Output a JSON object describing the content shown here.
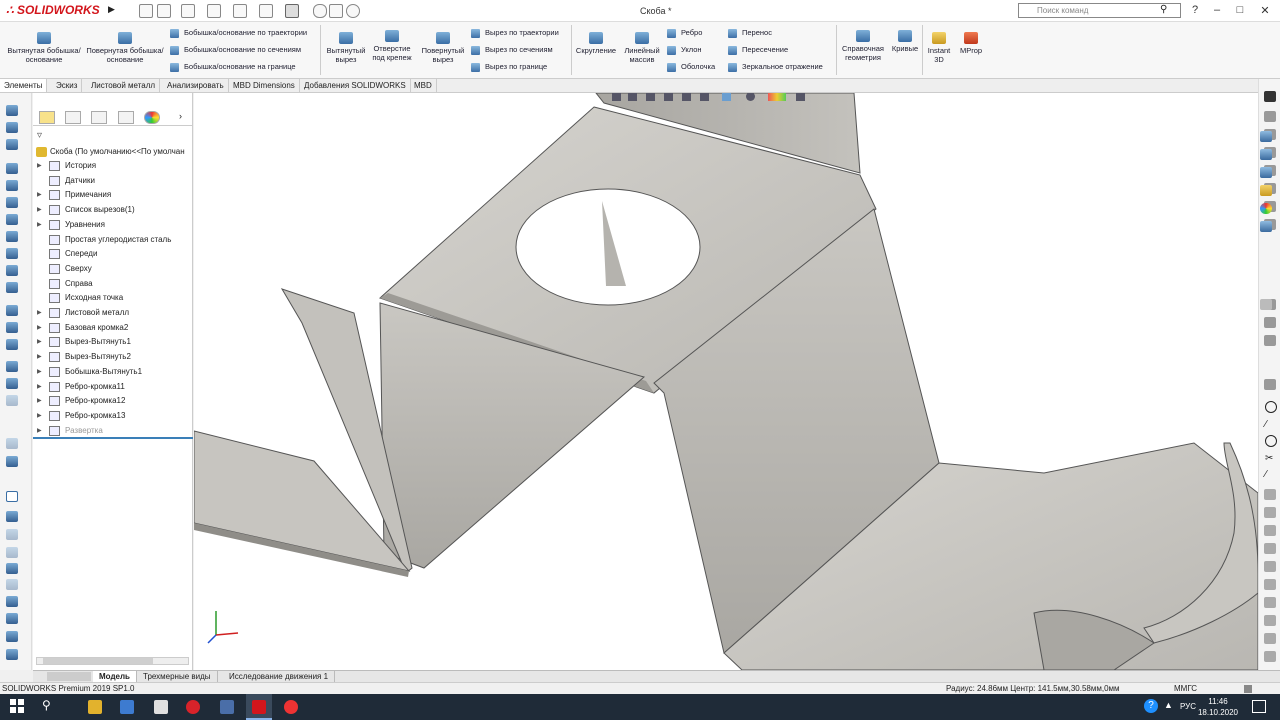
{
  "app": {
    "brand": "SOLIDWORKS",
    "document_title": "Скоба *",
    "search_placeholder": "Поиск команд"
  },
  "ribbon": {
    "big_buttons": [
      {
        "label": "Вытянутая бобышка/основание"
      },
      {
        "label": "Повернутая бобышка/основание"
      },
      {
        "label": "Вытянутый вырез"
      },
      {
        "label": "Отверстие под крепеж"
      },
      {
        "label": "Повернутый вырез"
      },
      {
        "label": "Скругление"
      },
      {
        "label": "Линейный массив"
      },
      {
        "label": "Справочная геометрия"
      },
      {
        "label": "Кривые"
      },
      {
        "label": "Instant 3D"
      },
      {
        "label": "MProp"
      }
    ],
    "boss_rows": [
      "Бобышка/основание по траектории",
      "Бобышка/основание по сечениям",
      "Бобышка/основание на границе"
    ],
    "cut_rows": [
      "Вырез по траектории",
      "Вырез по сечениям",
      "Вырез по границе"
    ],
    "feature_rows": [
      "Ребро",
      "Уклон",
      "Оболочка"
    ],
    "transform_rows": [
      "Перенос",
      "Пересечение",
      "Зеркальное отражение"
    ]
  },
  "command_tabs": [
    "Элементы",
    "Эскиз",
    "Листовой металл",
    "Анализировать",
    "MBD Dimensions",
    "Добавления SOLIDWORKS",
    "MBD"
  ],
  "tree": {
    "root": "Скоба  (По умолчанию<<По умолчан",
    "items": [
      {
        "label": "История",
        "expandable": true,
        "icon": "history-icon"
      },
      {
        "label": "Датчики",
        "expandable": false,
        "icon": "sensor-icon"
      },
      {
        "label": "Примечания",
        "expandable": true,
        "icon": "annotation-icon"
      },
      {
        "label": "Список вырезов(1)",
        "expandable": true,
        "icon": "cutlist-icon"
      },
      {
        "label": "Уравнения",
        "expandable": true,
        "icon": "equation-icon"
      },
      {
        "label": "Простая углеродистая сталь",
        "expandable": false,
        "icon": "material-icon"
      },
      {
        "label": "Спереди",
        "expandable": false,
        "icon": "plane-icon"
      },
      {
        "label": "Сверху",
        "expandable": false,
        "icon": "plane-icon"
      },
      {
        "label": "Справа",
        "expandable": false,
        "icon": "plane-icon"
      },
      {
        "label": "Исходная точка",
        "expandable": false,
        "icon": "origin-icon"
      },
      {
        "label": "Листовой металл",
        "expandable": true,
        "icon": "sheetmetal-icon"
      },
      {
        "label": "Базовая кромка2",
        "expandable": true,
        "icon": "feature-icon"
      },
      {
        "label": "Вырез-Вытянуть1",
        "expandable": true,
        "icon": "feature-icon"
      },
      {
        "label": "Вырез-Вытянуть2",
        "expandable": true,
        "icon": "feature-icon"
      },
      {
        "label": "Бобышка-Вытянуть1",
        "expandable": true,
        "icon": "feature-icon"
      },
      {
        "label": "Ребро-кромка11",
        "expandable": true,
        "icon": "feature-icon"
      },
      {
        "label": "Ребро-кромка12",
        "expandable": true,
        "icon": "feature-icon"
      },
      {
        "label": "Ребро-кромка13",
        "expandable": true,
        "icon": "feature-icon"
      },
      {
        "label": "Развертка",
        "expandable": true,
        "icon": "flatpattern-icon",
        "muted": true
      }
    ]
  },
  "bottom_tabs": [
    "Модель",
    "Трехмерные виды",
    "Исследование движения 1"
  ],
  "status": {
    "product": "SOLIDWORKS Premium 2019 SP1.0",
    "measure": "Радиус: 24.86мм  Центр: 141.5мм,30.58мм,0мм",
    "units": "ММГС"
  },
  "taskbar": {
    "lang": "РУС",
    "time": "11:46",
    "date": "18.10.2020"
  },
  "colors": {
    "brand_red": "#d3161c",
    "model_gray": "#b9b7b2",
    "taskbar": "#1f2b38",
    "icon_blue": "#3a6ea5"
  }
}
